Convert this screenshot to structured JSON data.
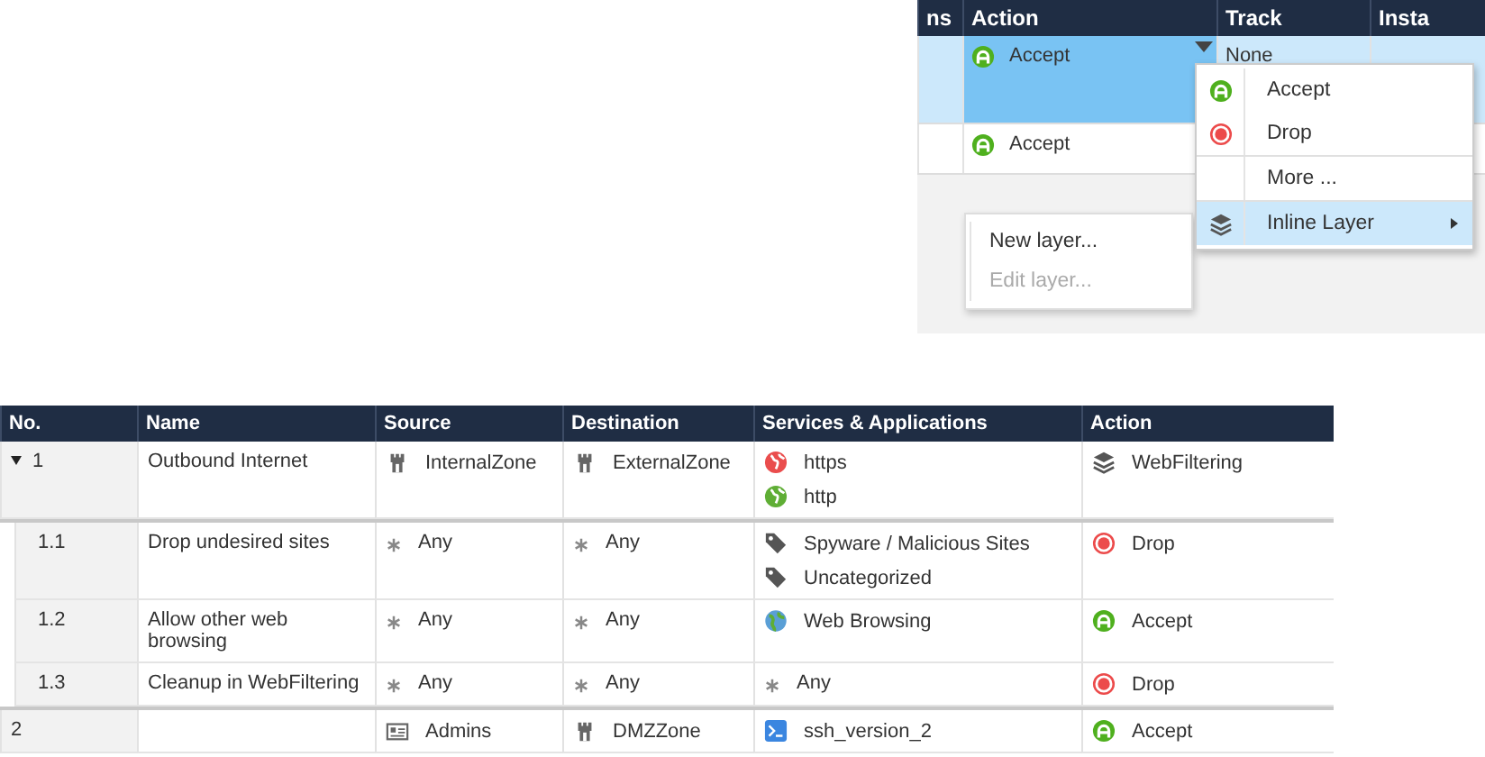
{
  "policy_panel": {
    "columns": [
      "ns",
      "Action",
      "Track",
      "Insta"
    ],
    "rows": [
      {
        "selected": true,
        "action": {
          "kind": "accept",
          "label": "Accept"
        },
        "track": "None"
      },
      {
        "selected": false,
        "action": {
          "kind": "accept",
          "label": "Accept"
        }
      }
    ],
    "action_menu": {
      "items": [
        {
          "kind": "accept",
          "label": "Accept",
          "selected": false
        },
        {
          "kind": "drop",
          "label": "Drop",
          "selected": false
        },
        {
          "kind": "more",
          "label": "More ...",
          "selected": false
        },
        {
          "kind": "layer",
          "label": "Inline Layer",
          "selected": true
        }
      ]
    },
    "layer_submenu": {
      "items": [
        {
          "label": "New layer...",
          "disabled": false
        },
        {
          "label": "Edit layer...",
          "disabled": true
        }
      ]
    }
  },
  "rules_table": {
    "columns": [
      "No.",
      "Name",
      "Source",
      "Destination",
      "Services & Applications",
      "Action"
    ],
    "rows": [
      {
        "number": "1",
        "expanded": true,
        "name": "Outbound Internet",
        "source": {
          "kind": "zone",
          "label": "InternalZone"
        },
        "destination": {
          "kind": "zone",
          "label": "ExternalZone"
        },
        "services": [
          {
            "kind": "globe",
            "label": "https",
            "color": "#ea4d4d"
          },
          {
            "kind": "globe",
            "label": "http",
            "color": "#5fae35"
          }
        ],
        "action": {
          "kind": "layer",
          "label": "WebFiltering"
        },
        "children": [
          {
            "number": "1.1",
            "name": "Drop undesired sites",
            "source": {
              "kind": "any",
              "label": "Any"
            },
            "destination": {
              "kind": "any",
              "label": "Any"
            },
            "services": [
              {
                "kind": "category",
                "label": "Spyware / Malicious Sites"
              },
              {
                "kind": "category",
                "label": "Uncategorized"
              }
            ],
            "action": {
              "kind": "drop",
              "label": "Drop"
            }
          },
          {
            "number": "1.2",
            "name": "Allow other web browsing",
            "source": {
              "kind": "any",
              "label": "Any"
            },
            "destination": {
              "kind": "any",
              "label": "Any"
            },
            "services": [
              {
                "kind": "application",
                "label": "Web Browsing"
              }
            ],
            "action": {
              "kind": "accept",
              "label": "Accept"
            }
          },
          {
            "number": "1.3",
            "name": "Cleanup in WebFiltering",
            "source": {
              "kind": "any",
              "label": "Any"
            },
            "destination": {
              "kind": "any",
              "label": "Any"
            },
            "services": [
              {
                "kind": "any",
                "label": "Any"
              }
            ],
            "action": {
              "kind": "drop",
              "label": "Drop"
            }
          }
        ]
      },
      {
        "number": "2",
        "source": {
          "kind": "group",
          "label": "Admins"
        },
        "destination": {
          "kind": "zone",
          "label": "DMZZone"
        },
        "services": [
          {
            "kind": "service",
            "label": "ssh_version_2"
          }
        ],
        "action": {
          "kind": "accept",
          "label": "Accept"
        }
      }
    ]
  }
}
